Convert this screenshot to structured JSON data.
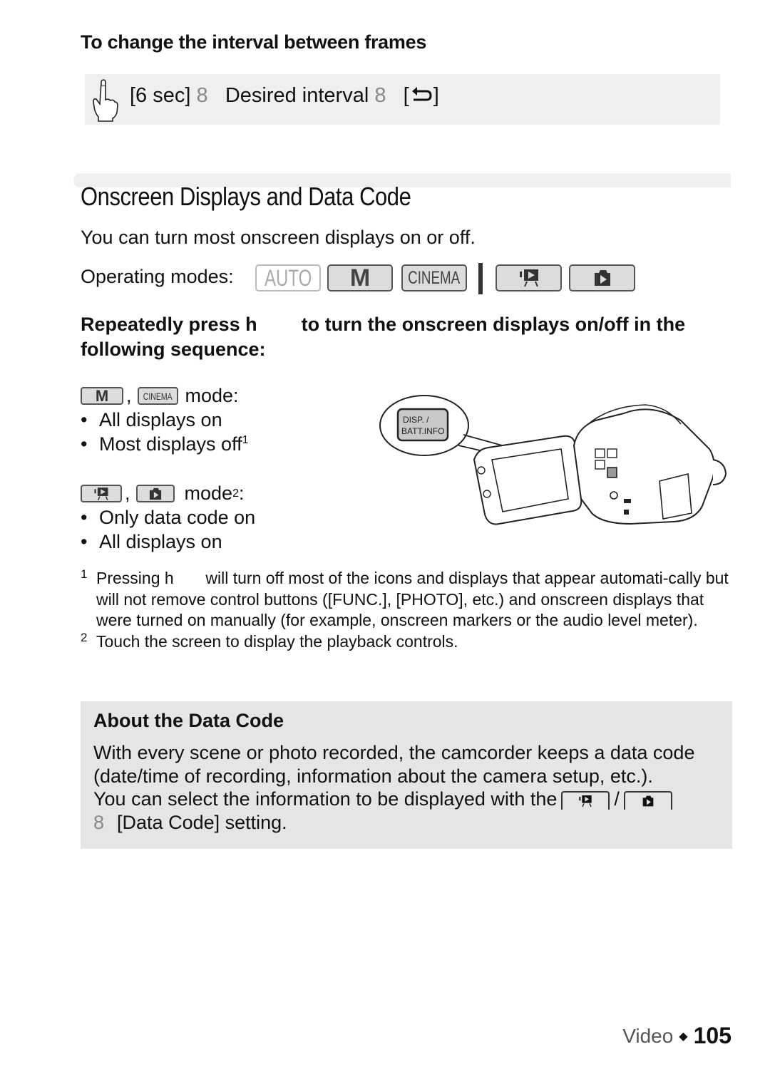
{
  "sub_heading": "To change the interval between frames",
  "step": {
    "icon": "touch-hand-icon",
    "item1": "[6 sec]",
    "arrow1": "8",
    "item2": "Desired interval",
    "arrow2": "8",
    "item3_open": "[",
    "item3_icon": "return-icon",
    "item3_close": "]"
  },
  "section_title": "Onscreen Displays and Data Code",
  "intro": "You can turn most onscreen displays on or off.",
  "operating_modes": {
    "label": "Operating modes:",
    "modes": [
      {
        "label": "AUTO",
        "enabled": false
      },
      {
        "label": "M",
        "enabled": true
      },
      {
        "label": "CINEMA",
        "enabled": true
      },
      {
        "label": "movie-playback",
        "enabled": true
      },
      {
        "label": "photo-playback",
        "enabled": true
      }
    ]
  },
  "instruction": {
    "part1": "Repeatedly press h",
    "part2": "to turn the onscreen displays on/off in the following sequence:"
  },
  "recording_modes": {
    "mode1": "M",
    "sep": ",",
    "mode2": "CINEMA",
    "suffix": "mode:",
    "items": [
      "All displays on",
      "Most displays off"
    ],
    "item2_sup": "1"
  },
  "playback_modes": {
    "sep": ",",
    "suffix": "mode",
    "suffix_sup": "2",
    "colon": ":",
    "items": [
      "Only data code on",
      "All displays on"
    ]
  },
  "illustration": {
    "callout_line1": "DISP. /",
    "callout_line2": "BATT.INFO"
  },
  "footnotes": [
    {
      "mark": "1",
      "text": "Pressing h       will turn off most of the icons and displays that appear automati-cally but will not remove control buttons ([FUNC.], [PHOTO], etc.) and onscreen displays that were turned on manually (for example, onscreen markers or the audio level meter)."
    },
    {
      "mark": "2",
      "text": "Touch the screen to display the playback controls."
    }
  ],
  "note": {
    "title": "About the Data Code",
    "line1": "With every scene or photo recorded, the camcorder keeps a data code (date/time of recording, information about the camera setup, etc.).",
    "line2": "You can select the information to be displayed with the",
    "slash": "/",
    "arrow": "8",
    "setting": "[Data Code] setting."
  },
  "footer": {
    "section": "Video",
    "separator": "◆",
    "page": "105"
  }
}
